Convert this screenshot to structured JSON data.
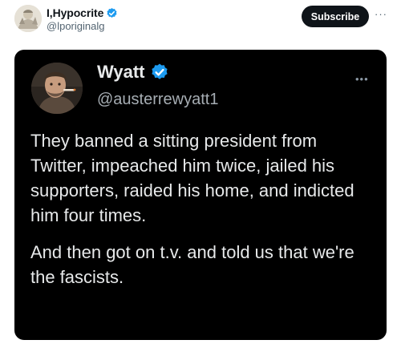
{
  "outer_post": {
    "author_name": "I,Hypocrite",
    "author_handle": "@lporiginalg",
    "subscribe_label": "Subscribe",
    "more_label": "···",
    "verified_color": "#1d9bf0"
  },
  "quoted_post": {
    "author_name": "Wyatt",
    "author_handle": "@austerrewyatt1",
    "more_label": "•••",
    "verified_color": "#1d9bf0",
    "paragraphs": [
      "They banned a sitting president from Twitter, impeached him twice, jailed his supporters, raided his home, and indicted him four times.",
      "And then got on t.v. and told us that we're the fascists."
    ]
  },
  "icons": [
    "verified-badge-icon",
    "avatar-illustration",
    "avatar-photo",
    "more-options-icon"
  ]
}
